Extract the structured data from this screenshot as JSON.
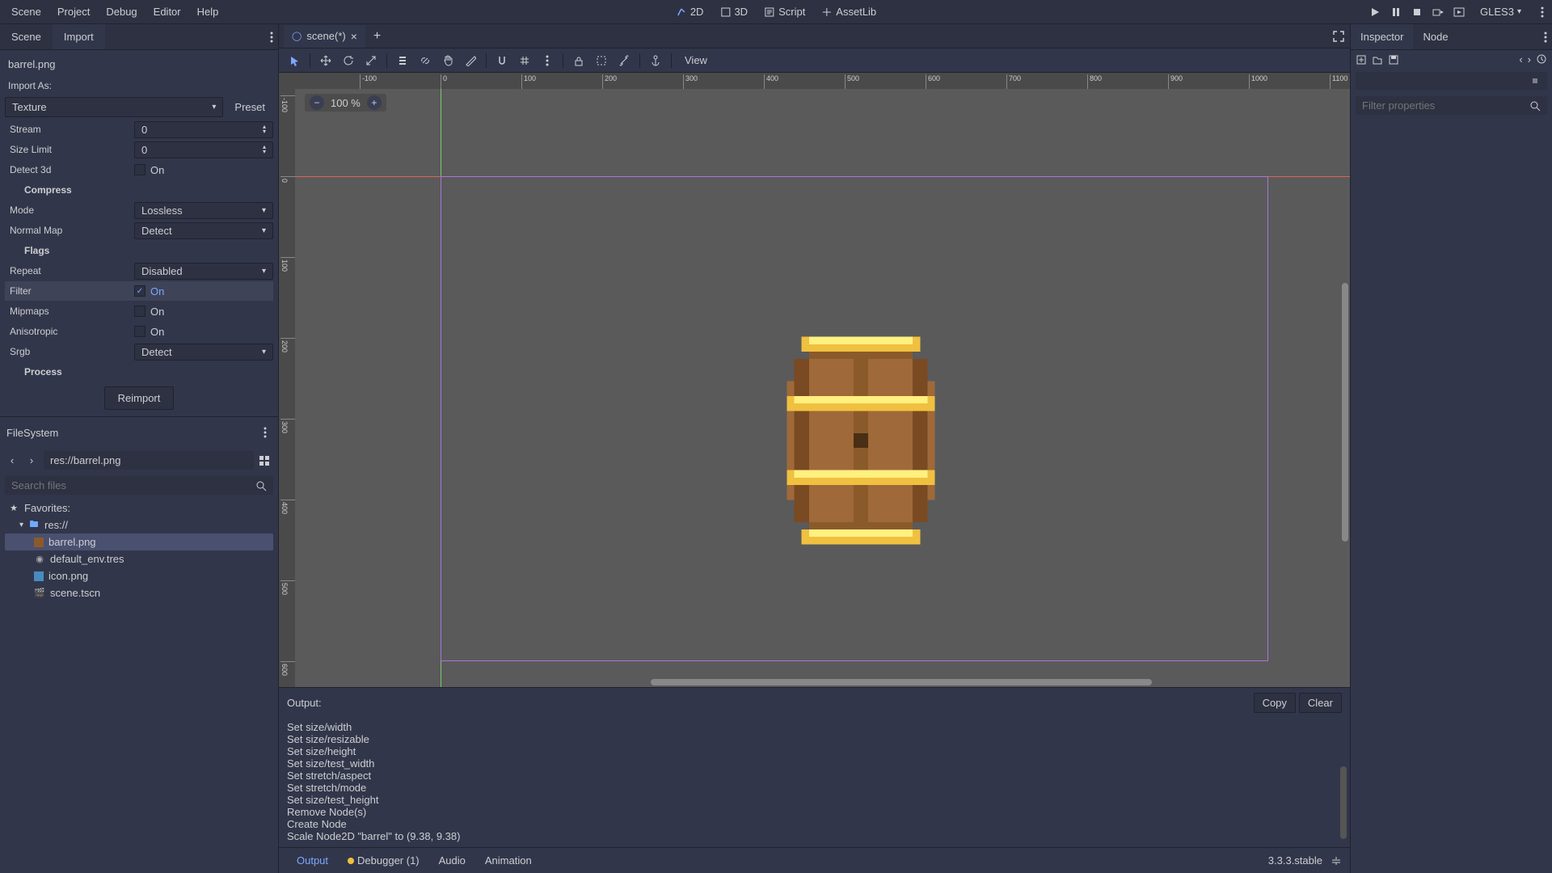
{
  "menu": {
    "scene": "Scene",
    "project": "Project",
    "debug": "Debug",
    "editor": "Editor",
    "help": "Help"
  },
  "top_center": {
    "2d": "2D",
    "3d": "3D",
    "script": "Script",
    "assetlib": "AssetLib"
  },
  "renderer": "GLES3",
  "left_tabs": {
    "scene": "Scene",
    "import": "Import"
  },
  "import": {
    "file": "barrel.png",
    "as_label": "Import As:",
    "as_value": "Texture",
    "preset": "Preset",
    "stream_label": "Stream",
    "stream_val": "0",
    "sizelimit_label": "Size Limit",
    "sizelimit_val": "0",
    "detect3d_label": "Detect 3d",
    "detect3d_on": "On",
    "compress": "Compress",
    "mode_label": "Mode",
    "mode_val": "Lossless",
    "nmap_label": "Normal Map",
    "nmap_val": "Detect",
    "flags": "Flags",
    "repeat_label": "Repeat",
    "repeat_val": "Disabled",
    "filter_label": "Filter",
    "filter_on": "On",
    "mipmaps_label": "Mipmaps",
    "mipmaps_on": "On",
    "aniso_label": "Anisotropic",
    "aniso_on": "On",
    "srgb_label": "Srgb",
    "srgb_val": "Detect",
    "process": "Process",
    "reimport": "Reimport"
  },
  "fs": {
    "title": "FileSystem",
    "path": "res://barrel.png",
    "search_placeholder": "Search files",
    "favorites": "Favorites:",
    "root": "res://",
    "f1": "barrel.png",
    "f2": "default_env.tres",
    "f3": "icon.png",
    "f4": "scene.tscn"
  },
  "scene_tab": "scene(*)",
  "toolbar": {
    "view": "View"
  },
  "zoom": "100 %",
  "output": {
    "title": "Output:",
    "copy": "Copy",
    "clear": "Clear",
    "lines": "Set size/width\nSet size/resizable\nSet size/height\nSet size/test_width\nSet stretch/aspect\nSet stretch/mode\nSet size/test_height\nRemove Node(s)\nCreate Node\nScale Node2D \"barrel\" to (9.38, 9.38)"
  },
  "bottom_tabs": {
    "output": "Output",
    "debugger": "Debugger (1)",
    "audio": "Audio",
    "anim": "Animation"
  },
  "version": "3.3.3.stable",
  "inspector": {
    "tab_i": "Inspector",
    "tab_n": "Node",
    "filter_placeholder": "Filter properties"
  }
}
